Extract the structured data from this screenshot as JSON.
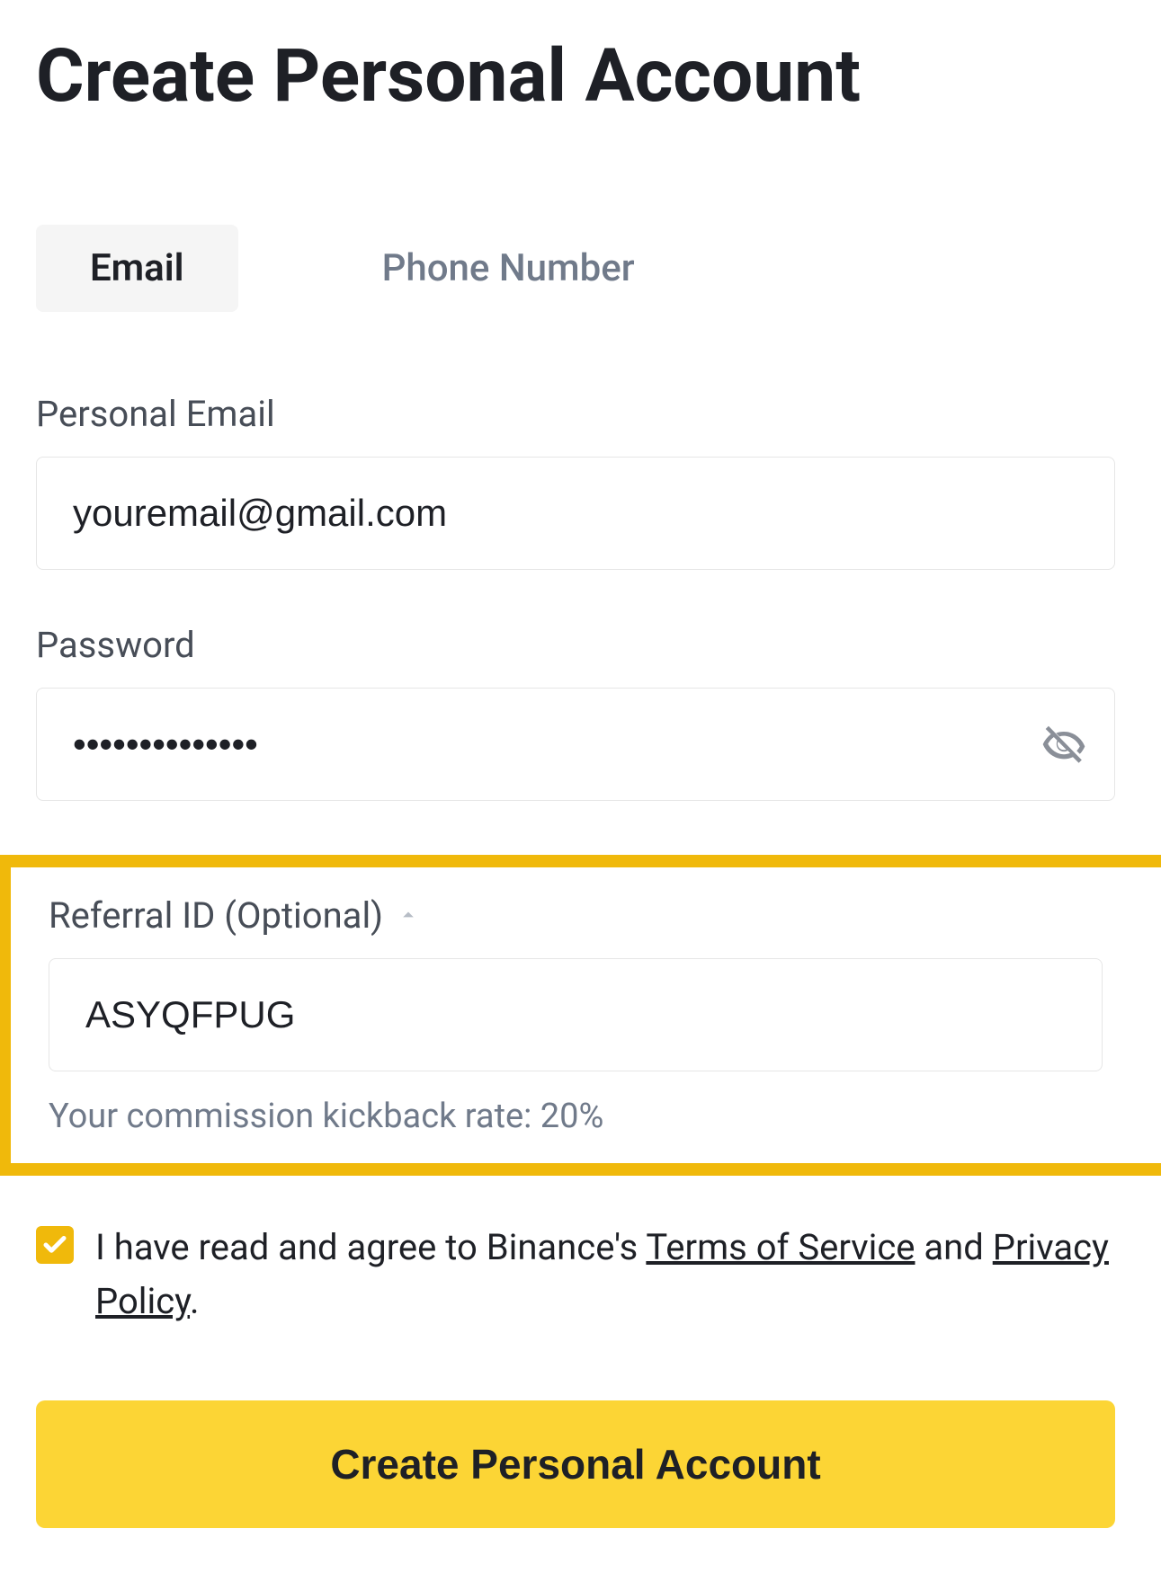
{
  "title": "Create Personal Account",
  "tabs": {
    "email": "Email",
    "phone": "Phone Number"
  },
  "email_field": {
    "label": "Personal Email",
    "value": "youremail@gmail.com"
  },
  "password_field": {
    "label": "Password",
    "value": "••••••••••••••"
  },
  "referral": {
    "label": "Referral ID (Optional)",
    "value": "ASYQFPUG",
    "helper": "Your commission kickback rate: 20%"
  },
  "terms": {
    "prefix": "I have read and agree to Binance's ",
    "tos": "Terms of Service",
    "mid": " and ",
    "privacy": "Privacy Policy",
    "suffix": "."
  },
  "submit": "Create Personal Account",
  "icons": {
    "eye_off": "eye-off-icon",
    "caret_up": "caret-up-icon",
    "check": "check-icon"
  }
}
